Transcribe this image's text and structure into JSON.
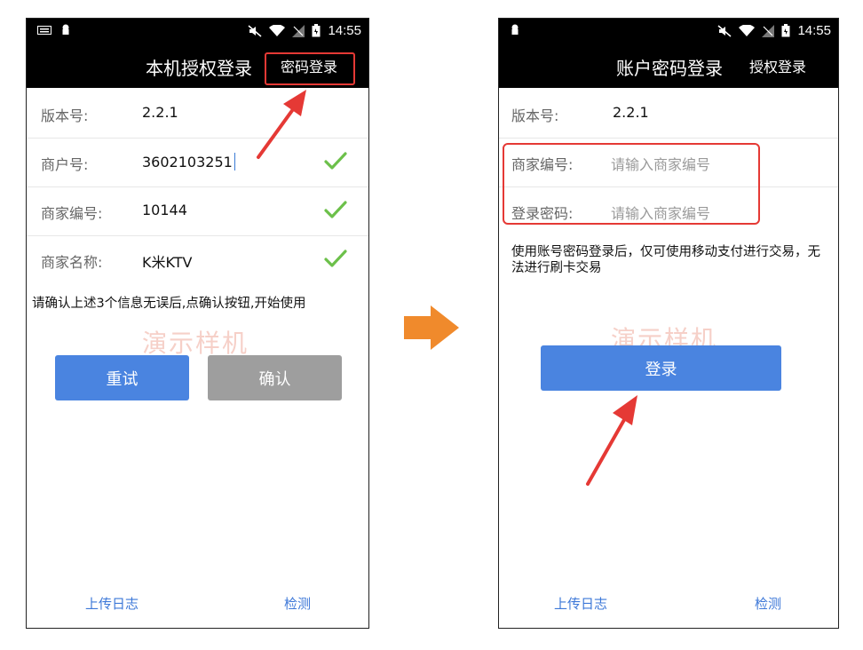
{
  "left": {
    "status": {
      "time": "14:55"
    },
    "appbar": {
      "title": "本机授权登录",
      "action": "密码登录"
    },
    "fields": [
      {
        "label": "版本号:",
        "value": "2.2.1",
        "verified": false
      },
      {
        "label": "商户号:",
        "value": "3602103251",
        "verified": true
      },
      {
        "label": "商家编号:",
        "value": "10144",
        "verified": true
      },
      {
        "label": "商家名称:",
        "value": "K米KTV",
        "verified": true
      }
    ],
    "hint": "请确认上述3个信息无误后,点确认按钮,开始使用",
    "watermark": "演示样机",
    "buttons": {
      "retry": "重试",
      "confirm": "确认"
    },
    "footer": {
      "upload_log": "上传日志",
      "detect": "检测"
    }
  },
  "right": {
    "status": {
      "time": "14:55"
    },
    "appbar": {
      "title": "账户密码登录",
      "action": "授权登录"
    },
    "version": {
      "label": "版本号:",
      "value": "2.2.1"
    },
    "inputs": [
      {
        "label": "商家编号:",
        "placeholder": "请输入商家编号"
      },
      {
        "label": "登录密码:",
        "placeholder": "请输入商家编号"
      }
    ],
    "hint": "使用账号密码登录后，仅可使用移动支付进行交易，无法进行刷卡交易",
    "watermark": "演示样机",
    "buttons": {
      "login": "登录"
    },
    "footer": {
      "upload_log": "上传日志",
      "detect": "检测"
    }
  },
  "colors": {
    "accent_blue": "#4a84e0",
    "highlight_red": "#e53935",
    "check_green": "#6cc04a",
    "transition_arrow": "#f08a2c"
  },
  "icons": [
    "keyboard-icon",
    "android-icon",
    "mute-icon",
    "wifi-icon",
    "no-signal-icon",
    "battery-icon",
    "checkmark-icon",
    "annotation-arrow-icon",
    "transition-arrow-icon"
  ]
}
